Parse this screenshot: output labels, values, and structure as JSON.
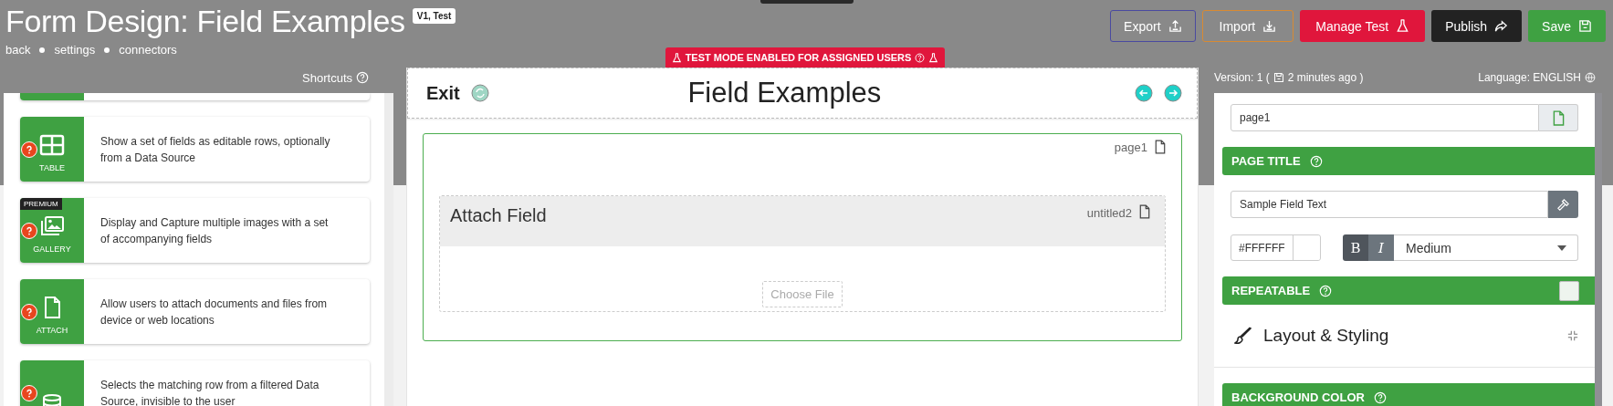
{
  "header": {
    "title": "Form Design: Field Examples",
    "badge": "V1, Test",
    "links": [
      "back",
      "settings",
      "connectors"
    ],
    "buttons": [
      {
        "label": "Export",
        "kind": "export"
      },
      {
        "label": "Import",
        "kind": "import"
      },
      {
        "label": "Manage Test",
        "kind": "test"
      },
      {
        "label": "Publish",
        "kind": "publish"
      },
      {
        "label": "Save",
        "kind": "save"
      }
    ]
  },
  "test_banner": "TEST MODE ENABLED FOR ASSIGNED USERS",
  "shortcuts": {
    "label": "Shortcuts",
    "items": [
      {
        "kind": "table",
        "label": "TABLE",
        "description": "Show a set of fields as editable rows, optionally from a Data Source"
      },
      {
        "kind": "gallery",
        "label": "GALLERY",
        "badge": "PREMIUM",
        "description": "Display and Capture multiple images with a set of accompanying fields"
      },
      {
        "kind": "attach",
        "label": "ATTACH",
        "description": "Allow users to attach documents and files from device or web locations"
      },
      {
        "kind": "data",
        "description": "Selects the matching row from a filtered Data Source, invisible to the user"
      }
    ]
  },
  "canvas": {
    "exit": "Exit",
    "title": "Field Examples",
    "page": {
      "name": "page1",
      "field": {
        "title": "Attach Field",
        "name": "untitled2",
        "button": "Choose File"
      }
    }
  },
  "properties": {
    "version": "Version: 1 (",
    "saved": "2 minutes ago )",
    "language": "Language: ENGLISH",
    "page_name": "page1",
    "page_title": {
      "label": "PAGE TITLE",
      "value": "Sample Field Text",
      "color": "#FFFFFF",
      "bold": true,
      "bold_label": "B",
      "italic": false,
      "italic_label": "I",
      "size": "Medium"
    },
    "repeatable": {
      "label": "REPEATABLE",
      "checked": false
    },
    "section": {
      "title": "Layout & Styling",
      "expanded": true
    },
    "background_color": {
      "label": "BACKGROUND COLOR"
    }
  }
}
